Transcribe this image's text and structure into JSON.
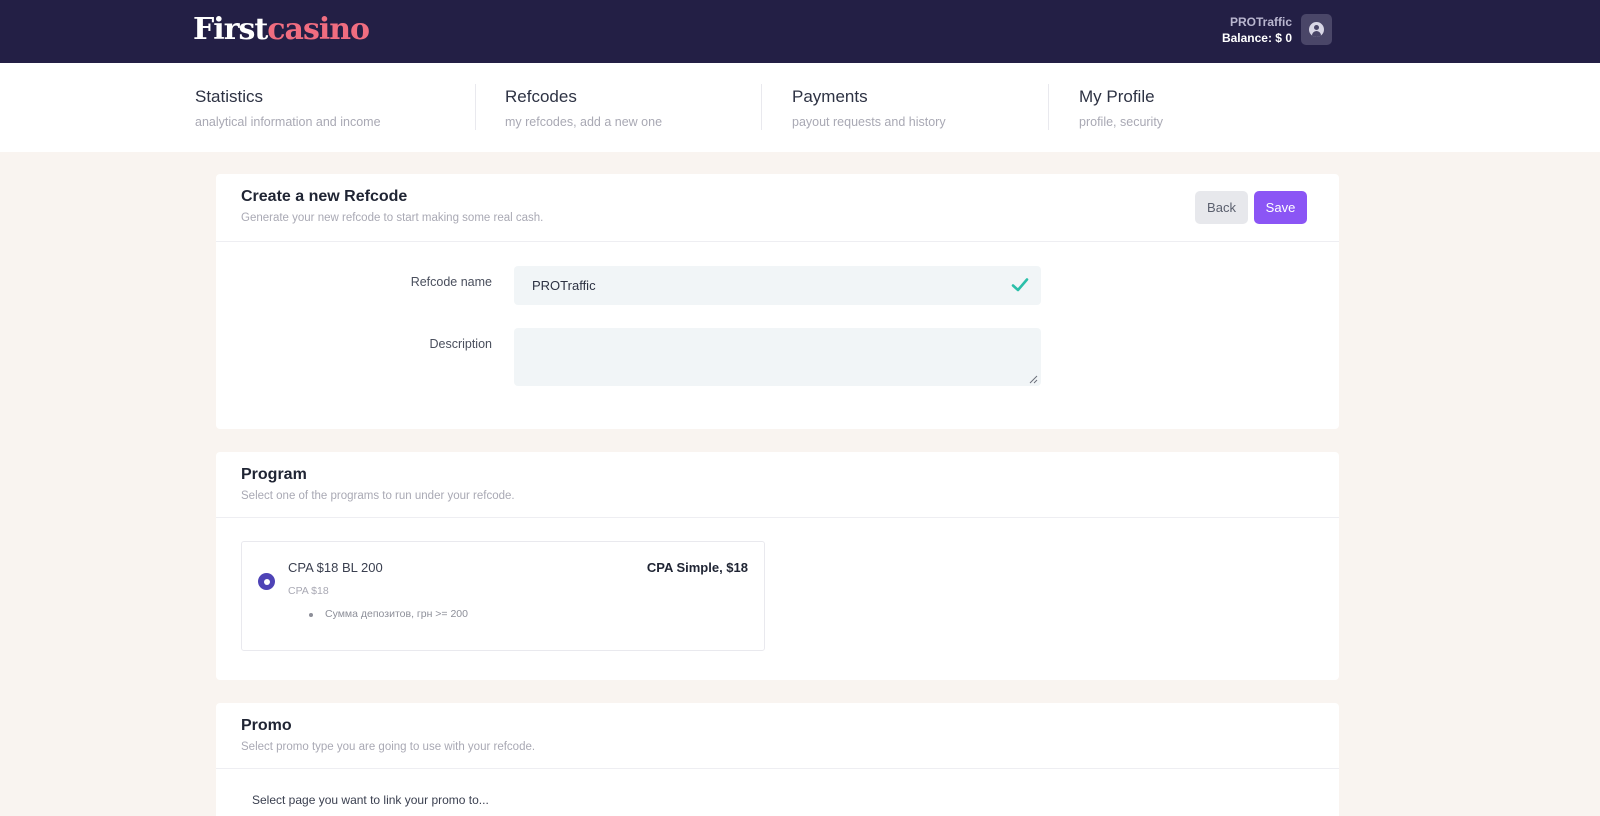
{
  "header": {
    "logo_first": "First",
    "logo_casino": "casino",
    "user_name": "PROTraffic",
    "balance": "Balance: $ 0",
    "avatar_icon": "user-icon"
  },
  "nav": [
    {
      "title": "Statistics",
      "subtitle": "analytical information and income"
    },
    {
      "title": "Refcodes",
      "subtitle": "my refcodes, add a new one"
    },
    {
      "title": "Payments",
      "subtitle": "payout requests and history"
    },
    {
      "title": "My Profile",
      "subtitle": "profile, security"
    }
  ],
  "create_card": {
    "title": "Create a new Refcode",
    "subtitle": "Generate your new refcode to start making some real cash.",
    "back_label": "Back",
    "save_label": "Save",
    "refcode_label": "Refcode name",
    "refcode_value": "PROTraffic",
    "description_label": "Description",
    "description_value": ""
  },
  "program_card": {
    "title": "Program",
    "subtitle": "Select one of the programs to run under your refcode.",
    "program": {
      "name": "CPA $18 BL 200",
      "type": "CPA Simple, $18",
      "sub": "CPA $18",
      "condition": "Сумма депозитов, грн >= 200",
      "selected": true
    }
  },
  "promo_card": {
    "title": "Promo",
    "subtitle": "Select promo type you are going to use with your refcode.",
    "select_label": "Select page you want to link your promo to..."
  },
  "colors": {
    "header_bg": "#231f45",
    "accent": "#8b55f5",
    "logo_accent": "#f06d80",
    "radio": "#4e43b6",
    "check": "#2bbfa9",
    "page_bg": "#f9f4f0"
  }
}
